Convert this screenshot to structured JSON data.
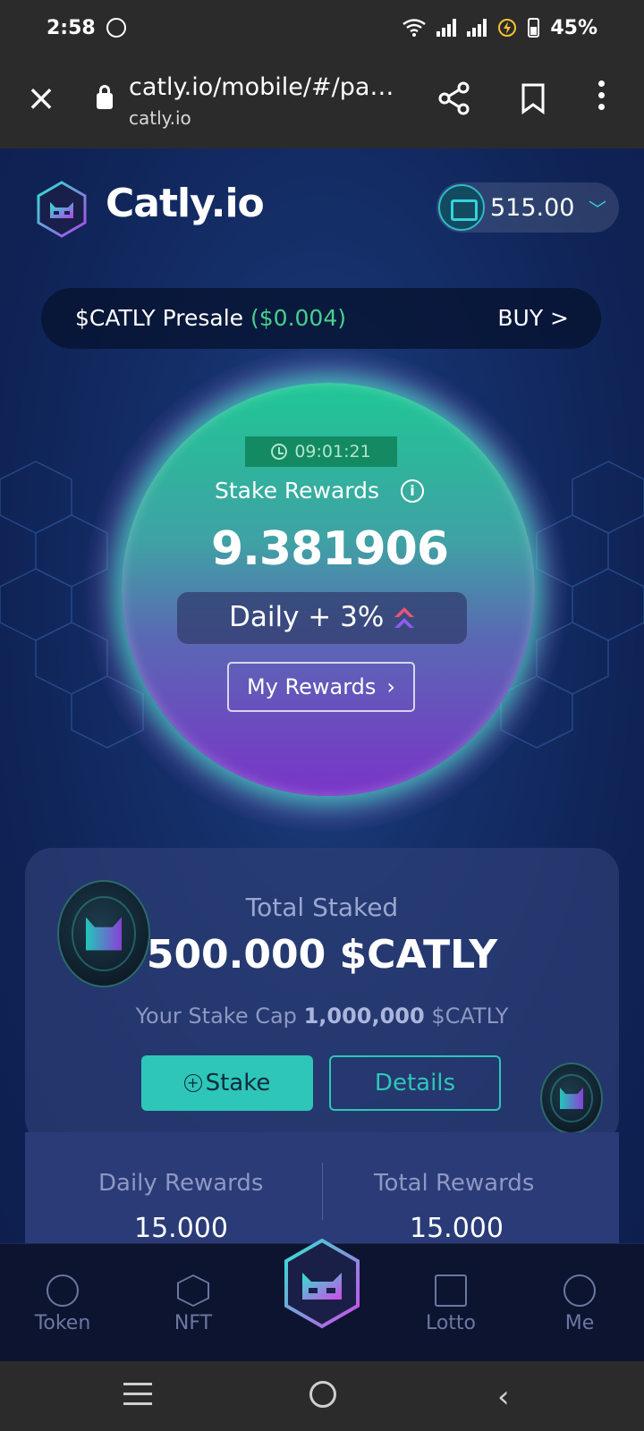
{
  "status_bar": {
    "time": "2:58",
    "battery": "45%"
  },
  "browser": {
    "url": "catly.io/mobile/#/pa…",
    "host": "catly.io"
  },
  "app": {
    "brand": "Catly.io",
    "wallet_balance": "515.00",
    "presale": {
      "label": "$CATLY Presale",
      "price": "($0.004)",
      "buy": "BUY >"
    },
    "rewards": {
      "timer": "09:01:21",
      "label": "Stake Rewards",
      "value": "9.381906",
      "daily": "Daily + 3%",
      "my_rewards": "My Rewards"
    },
    "staked": {
      "label": "Total Staked",
      "value": "500.000 $CATLY",
      "cap_prefix": "Your Stake Cap",
      "cap_value": "1,000,000",
      "cap_suffix": "$CATLY",
      "stake_button": "Stake",
      "details_button": "Details"
    },
    "stats": {
      "daily_label": "Daily Rewards",
      "daily_value": "15.000",
      "total_label": "Total Rewards",
      "total_value": "15.000"
    }
  },
  "nav": {
    "token": "Token",
    "nft": "NFT",
    "lotto": "Lotto",
    "me": "Me"
  },
  "colors": {
    "accent": "#2ec6b8",
    "price_green": "#46d18c"
  }
}
